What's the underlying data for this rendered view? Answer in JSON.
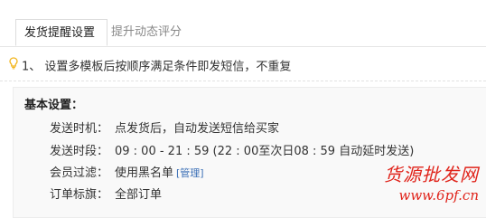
{
  "tabs": [
    {
      "label": "发货提醒设置"
    },
    {
      "label": "提升动态评分"
    }
  ],
  "tip": {
    "text": "1、 设置多模板后按顺序满足条件即发短信，不重复"
  },
  "settings": {
    "title": "基本设置：",
    "rows": [
      {
        "label": "发送时机：",
        "value": "点发货后，自动发送短信给买家"
      },
      {
        "label": "发送时段：",
        "value": "09 : 00 - 21 : 59 (22 : 00至次日08 : 59 自动延时发送)"
      },
      {
        "label": "会员过滤：",
        "value": "使用黑名单",
        "link": "[管理]"
      },
      {
        "label": "订单标旗：",
        "value": "全部订单"
      }
    ]
  },
  "watermark": {
    "top": "货源批发网",
    "bottom": "www.6pf.cn"
  },
  "colors": {
    "accent_link": "#3b6fb6",
    "bulb": "#f2b51b",
    "watermark": "#e0241b",
    "panel_bg": "#f9f9f9"
  }
}
